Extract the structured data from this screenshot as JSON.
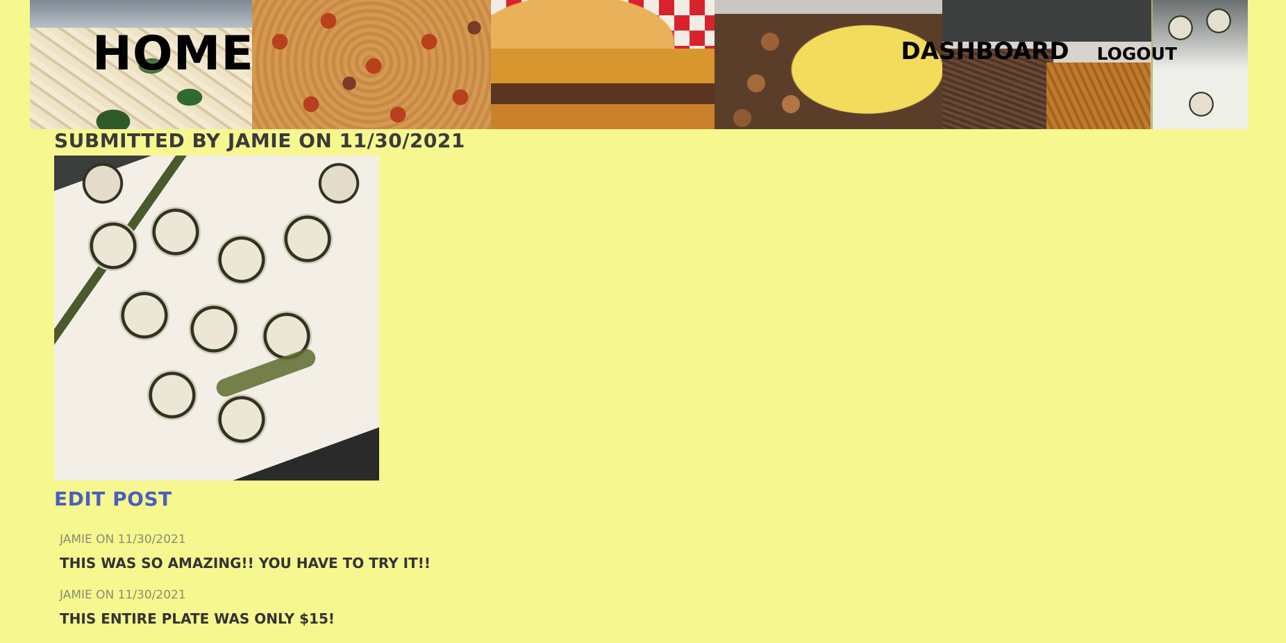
{
  "header": {
    "home_label": "HOME",
    "nav": {
      "dashboard_label": "DASHBOARD",
      "logout_label": "LOGOUT"
    }
  },
  "post": {
    "submitted_line": "SUBMITTED BY JAMIE ON 11/30/2021",
    "edit_label": "EDIT POST"
  },
  "comments": [
    {
      "meta": "JAMIE ON 11/30/2021",
      "text": "THIS WAS SO AMAZING!! YOU HAVE TO TRY IT!!"
    },
    {
      "meta": "JAMIE ON 11/30/2021",
      "text": "THIS ENTIRE PLATE WAS ONLY $15!"
    }
  ],
  "colors": {
    "background": "#f6f78f",
    "link": "#4a5fc1",
    "meta_text": "#8b8b72"
  }
}
